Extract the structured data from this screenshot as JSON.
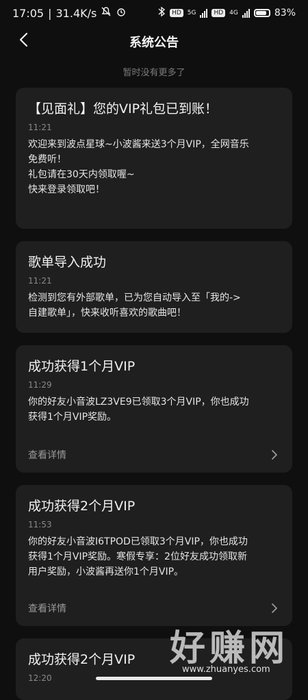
{
  "status_bar": {
    "time": "17:05",
    "speed": "31.4K/s",
    "hd_badge_1": "HD",
    "network_5g": "5G",
    "hd_badge_2": "HD",
    "network_4g": "4G",
    "battery_percent_text": "83%",
    "battery_level": 0.83
  },
  "header": {
    "title": "系统公告",
    "back_icon": "chevron-left-icon"
  },
  "no_more_text": "暂时没有更多了",
  "cards": [
    {
      "title": "【见面礼】您的VIP礼包已到账！",
      "time": "11:21",
      "body": "欢迎来到波点星球~小波酱来送3个月VIP，全网音乐\n免费听！\n礼包请在30天内领取喔~\n快来登录领取吧！"
    },
    {
      "title": "歌单导入成功",
      "time": "11:21",
      "body": "检测到您有外部歌单，已为您自动导入至「我的->\n自建歌单」，快来收听喜欢的歌曲吧！"
    },
    {
      "title": "成功获得1个月VIP",
      "time": "11:29",
      "body": "你的好友小音波LZ3VE9已领取3个月VIP，你也成功\n获得1个月VIP奖励。",
      "footer_label": "查看详情"
    },
    {
      "title": "成功获得2个月VIP",
      "time": "11:53",
      "body": "你的好友小音波I6TPOD已领取3个月VIP，你也成功\n获得1个月VIP奖励。寒假专享：2位好友成功领取新\n用户奖励，小波酱再送你1个月VIP。",
      "footer_label": "查看详情"
    },
    {
      "title": "成功获得2个月VIP",
      "time": "12:20"
    }
  ],
  "watermark": {
    "text": "好赚网",
    "url": "www.zhuanyes.com"
  },
  "colors": {
    "background": "#0f0f0f",
    "card": "#1f1f1f",
    "muted": "#8a8a8a"
  }
}
